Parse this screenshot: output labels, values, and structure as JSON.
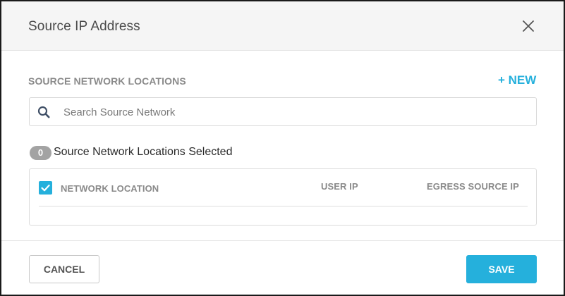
{
  "dialog": {
    "title": "Source IP Address",
    "close_icon": "close-icon"
  },
  "source_network": {
    "section_label": "SOURCE NETWORK LOCATIONS",
    "new_label": "+ NEW",
    "search": {
      "icon": "search-icon",
      "value": "",
      "placeholder": "Search Source Network"
    },
    "selected_count": "0",
    "selected_label": "Source Network Locations Selected"
  },
  "table": {
    "select_all_checked": true,
    "columns": [
      "NETWORK LOCATION",
      "USER IP",
      "EGRESS SOURCE IP"
    ],
    "rows": []
  },
  "footer": {
    "cancel_label": "CANCEL",
    "save_label": "SAVE"
  },
  "colors": {
    "accent": "#25b0dc",
    "header_bg": "#f5f5f5",
    "badge_bg": "#a3a3a3",
    "muted_text": "#8a8a8a"
  }
}
